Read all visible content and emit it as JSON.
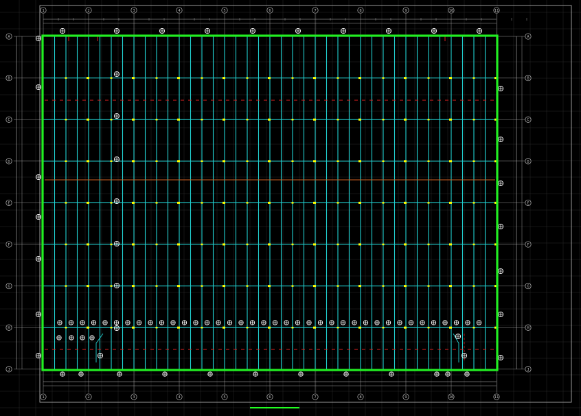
{
  "drawing": {
    "title": "",
    "scale": "",
    "grid_labels_top": [
      "1",
      "2",
      "3",
      "4",
      "5",
      "6",
      "7",
      "8",
      "9",
      "10",
      "11"
    ],
    "grid_labels_side": [
      "A",
      "B",
      "C",
      "D",
      "E",
      "F",
      "G",
      "H",
      "J"
    ],
    "centre_tag": ""
  },
  "colors": {
    "background": "#000000",
    "grid_lines": "#2a2a2a",
    "frame": "#bfbfbf",
    "beams": "#22d3d3",
    "wall": "#22ee22",
    "sprinkler_pipe": "#e02020",
    "main_pipe": "#d06020",
    "node": "#ffff00",
    "symbol": "#ffffff"
  }
}
